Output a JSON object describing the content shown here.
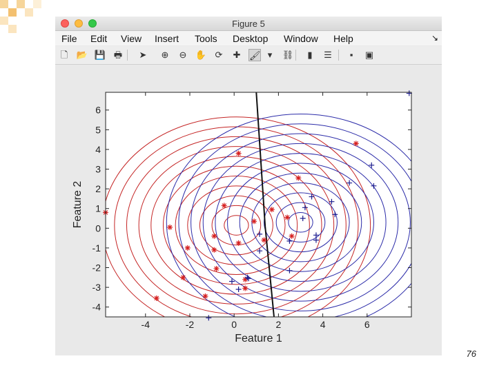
{
  "window": {
    "title": "Figure 5",
    "menu": [
      "File",
      "Edit",
      "View",
      "Insert",
      "Tools",
      "Desktop",
      "Window",
      "Help"
    ],
    "menu_overflow_icon": "arrow-icon",
    "toolbar": [
      {
        "name": "new-figure-icon",
        "glyph": "🗋"
      },
      {
        "name": "open-file-icon",
        "glyph": "📂"
      },
      {
        "name": "save-icon",
        "glyph": "💾"
      },
      {
        "name": "print-icon",
        "glyph": "🖶"
      },
      {
        "name": "edit-plot-cursor-icon",
        "glyph": "➤"
      },
      {
        "name": "zoom-in-icon",
        "glyph": "⊕"
      },
      {
        "name": "zoom-out-icon",
        "glyph": "⊖"
      },
      {
        "name": "pan-hand-icon",
        "glyph": "✋"
      },
      {
        "name": "rotate-3d-icon",
        "glyph": "⟳"
      },
      {
        "name": "data-cursor-icon",
        "glyph": "✚"
      },
      {
        "name": "brush-icon",
        "glyph": "🖌"
      },
      {
        "name": "brush-dropdown-icon",
        "glyph": "▾"
      },
      {
        "name": "link-plot-icon",
        "glyph": "⛓"
      },
      {
        "name": "colorbar-icon",
        "glyph": "▮"
      },
      {
        "name": "legend-icon",
        "glyph": "☰"
      },
      {
        "name": "hide-plot-tools-icon",
        "glyph": "▪"
      },
      {
        "name": "show-plot-tools-icon",
        "glyph": "▣"
      }
    ]
  },
  "page_number": "76",
  "chart_data": {
    "type": "scatter",
    "xlabel": "Feature 1",
    "ylabel": "Feature 2",
    "xlim": [
      -5.8,
      8
    ],
    "ylim": [
      -4.5,
      6.9
    ],
    "xticks": [
      -4,
      -2,
      0,
      2,
      4,
      6
    ],
    "yticks": [
      -4,
      -3,
      -2,
      -1,
      0,
      1,
      2,
      3,
      4,
      5,
      6
    ],
    "grid": false,
    "series": [
      {
        "marker": "*",
        "color": "#d62020",
        "points": [
          [
            -5.8,
            0.8
          ],
          [
            -2.9,
            0.05
          ],
          [
            -2.1,
            -1.0
          ],
          [
            -2.3,
            -2.5
          ],
          [
            -3.5,
            -3.55
          ],
          [
            -1.3,
            -3.45
          ],
          [
            -0.8,
            -2.05
          ],
          [
            -0.9,
            -1.1
          ],
          [
            -0.9,
            -0.4
          ],
          [
            -0.45,
            1.15
          ],
          [
            0.2,
            3.8
          ],
          [
            0.2,
            -0.75
          ],
          [
            0.5,
            -2.6
          ],
          [
            0.5,
            -3.05
          ],
          [
            0.9,
            0.35
          ],
          [
            1.35,
            -0.6
          ],
          [
            1.7,
            0.95
          ],
          [
            2.4,
            0.55
          ],
          [
            2.6,
            -0.4
          ],
          [
            2.9,
            2.55
          ],
          [
            5.5,
            4.3
          ]
        ]
      },
      {
        "marker": "+",
        "color": "#1a1a8c",
        "points": [
          [
            7.9,
            6.85
          ],
          [
            6.2,
            3.2
          ],
          [
            6.3,
            2.15
          ],
          [
            5.2,
            2.3
          ],
          [
            4.4,
            1.35
          ],
          [
            4.55,
            0.7
          ],
          [
            3.5,
            1.6
          ],
          [
            3.2,
            1.05
          ],
          [
            3.1,
            0.5
          ],
          [
            3.7,
            -0.35
          ],
          [
            3.7,
            -0.6
          ],
          [
            2.5,
            -0.65
          ],
          [
            2.5,
            -2.15
          ],
          [
            1.15,
            -0.3
          ],
          [
            1.15,
            -1.15
          ],
          [
            0.6,
            -2.5
          ],
          [
            0.65,
            -2.55
          ],
          [
            -0.1,
            -2.7
          ],
          [
            0.2,
            -3.1
          ],
          [
            -1.15,
            -4.55
          ]
        ]
      }
    ],
    "contour_groups": [
      {
        "color": "#c42323",
        "center": [
          0.1,
          0.15
        ],
        "radii": [
          [
            0.55,
            0.5
          ],
          [
            1.1,
            1.0
          ],
          [
            1.65,
            1.5
          ],
          [
            2.2,
            2.0
          ],
          [
            2.75,
            2.5
          ],
          [
            3.3,
            3.0
          ],
          [
            3.85,
            3.5
          ],
          [
            4.4,
            4.0
          ],
          [
            4.95,
            4.5
          ],
          [
            5.5,
            5.0
          ],
          [
            6.05,
            5.5
          ]
        ]
      },
      {
        "color": "#2a2aa8",
        "center": [
          3.0,
          0.3
        ],
        "radii": [
          [
            0.55,
            0.5
          ],
          [
            1.1,
            1.0
          ],
          [
            1.65,
            1.5
          ],
          [
            2.2,
            2.0
          ],
          [
            2.75,
            2.5
          ],
          [
            3.3,
            3.0
          ],
          [
            3.85,
            3.5
          ],
          [
            4.4,
            4.0
          ],
          [
            4.95,
            4.5
          ],
          [
            5.5,
            5.0
          ],
          [
            6.05,
            5.5
          ]
        ]
      }
    ],
    "boundary": [
      [
        1.0,
        6.9
      ],
      [
        1.4,
        0.1
      ],
      [
        1.8,
        -4.5
      ]
    ],
    "boundary_color": "#111111"
  }
}
